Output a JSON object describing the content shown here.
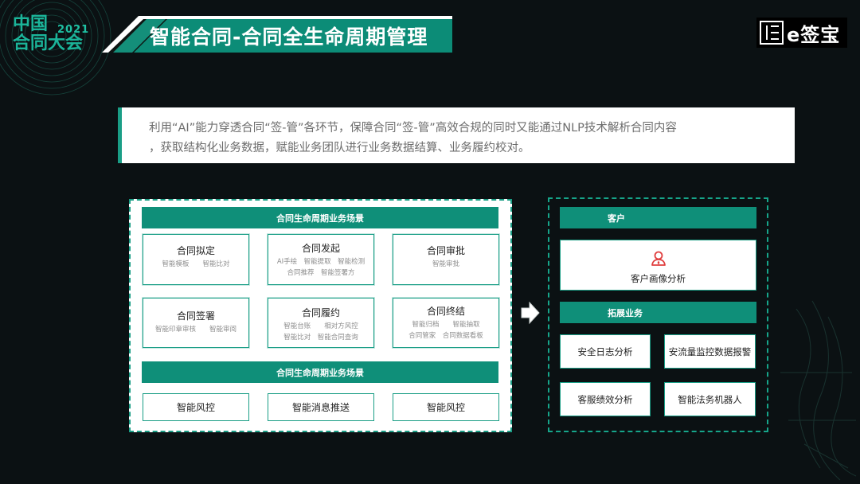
{
  "event_logo": {
    "line1": "中国",
    "line2": "合同大会",
    "year": "2021"
  },
  "page_title": "智能合同-合同全生命周期管理",
  "brand": {
    "name": "e签宝",
    "icon": "e-sign-logo-icon"
  },
  "description": {
    "line1": "利用“AI”能力穿透合同“签-管”各环节，保障合同“签-管”高效合规的同时又能通过NLP技术解析合同内容",
    "line2": "，获取结构化业务数据，赋能业务团队进行业务数据结算、业务履约校对。"
  },
  "left_panel": {
    "header_top": "合同生命周期业务场景",
    "cards": [
      {
        "title": "合同拟定",
        "lines": [
          "智能模板　　智能比对"
        ]
      },
      {
        "title": "合同发起",
        "lines": [
          "AI手绘　智能提取　智能检测",
          "合同推荐　智能签署方"
        ]
      },
      {
        "title": "合同审批",
        "lines": [
          "智能审批"
        ]
      },
      {
        "title": "合同签署",
        "lines": [
          "智能印章审核　　智能审阅"
        ]
      },
      {
        "title": "合同履约",
        "lines": [
          "智能台账　　相对方风控",
          "智能比对　智能合同查询"
        ]
      },
      {
        "title": "合同终结",
        "lines": [
          "智能归档　　智能抽取",
          "合同管家　合同数据看板"
        ]
      }
    ],
    "header_bottom": "合同生命周期业务场景",
    "bottom_items": [
      "智能风控",
      "智能消息推送",
      "智能风控"
    ]
  },
  "right_panel": {
    "customer_header": "客户",
    "customer_item": "客户画像分析",
    "customer_icon": "user-icon",
    "extend_header": "拓展业务",
    "extend_items": [
      "安全日志分析",
      "安流量监控数据报警",
      "客服绩效分析",
      "智能法务机器人"
    ]
  },
  "colors": {
    "accent": "#0f8f79",
    "border": "#1a9e86",
    "background": "#0b1113",
    "icon_red": "#e04040"
  }
}
